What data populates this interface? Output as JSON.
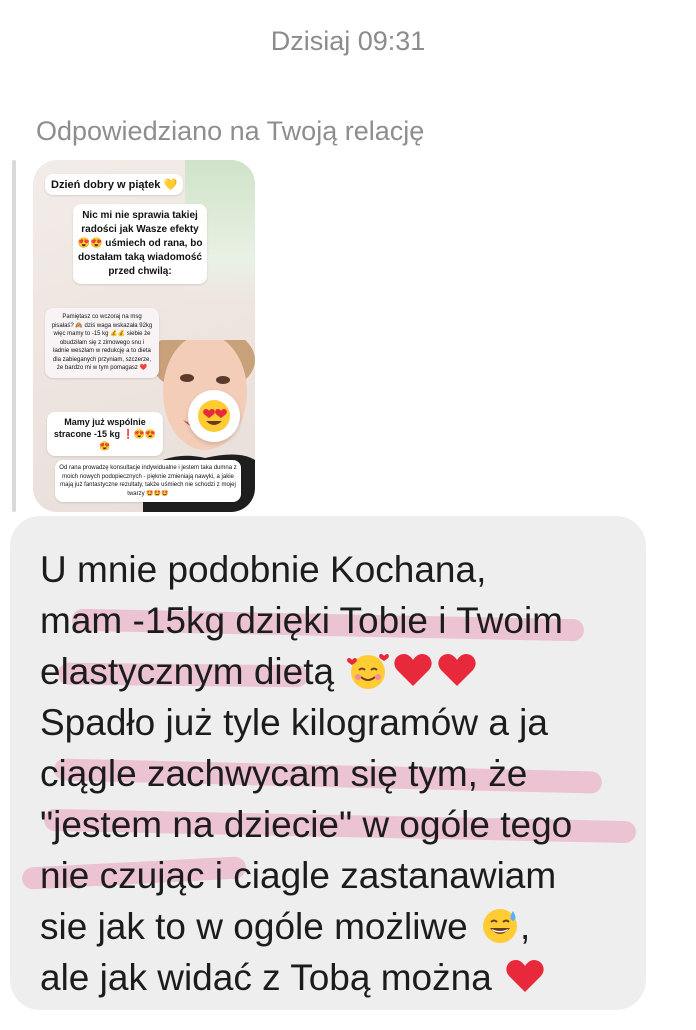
{
  "header": {
    "timestamp": "Dzisiaj 09:31"
  },
  "reply_context": {
    "label": "Odpowiedziano na Twoją relację"
  },
  "story_preview": {
    "greeting": "Dzień dobry w piątek 💛",
    "main_text": "Nic mi nie sprawia takiej radości jak Wasze efekty 😍😍 uśmiech od rana, bo dostałam taką wiadomość przed chwilą:",
    "quoted_message": "Pamiętasz co wczoraj na msg pisałaś? 🙈 dziś waga wskazała 92kg więc mamy to -15 kg 💰💰 siebie że obudziłam się z zimowego snu i ładnie weszłam w redukcję a to dieta dla zabieganych przyniam, szczerze, że bardzo mi w tym pomagasz ❤️",
    "together_text": "Mamy już wspólnie stracone -15 kg ❗😍😍😍",
    "bottom_text": "Od rana prowadzę konsultacje indywidualne i jestem taka dumna z moich nowych podopiecznych - pięknie zmieniają nawyki, a jakie mają już fantastyczne rezultaty, także uśmiech nie schodzi z mojej twarzy 🤩🤩🤩",
    "emoji_sticker": "heart-eyes-emoji"
  },
  "message": {
    "lines": [
      "U mnie podobnie Kochana,",
      "mam -15kg dzięki Tobie i Twoim",
      "elastycznym dietą",
      "Spadło już tyle kilogramów a ja",
      "ciągle zachwycam się tym, że",
      "\"jestem na dziecie\" w ogóle tego",
      "nie czując i ciagle zastanawiam",
      "sie jak to w ogóle możliwe",
      "ale jak widać z Tobą można"
    ],
    "line3_emojis": [
      "smiling-face-with-hearts-emoji",
      "red-heart-emoji",
      "red-heart-emoji"
    ],
    "line8_suffix": ",",
    "line8_emoji": "grinning-sweat-emoji",
    "line9_emoji": "red-heart-emoji",
    "highlight_color": "#e882aa",
    "bubble_color": "#eeeeee"
  }
}
